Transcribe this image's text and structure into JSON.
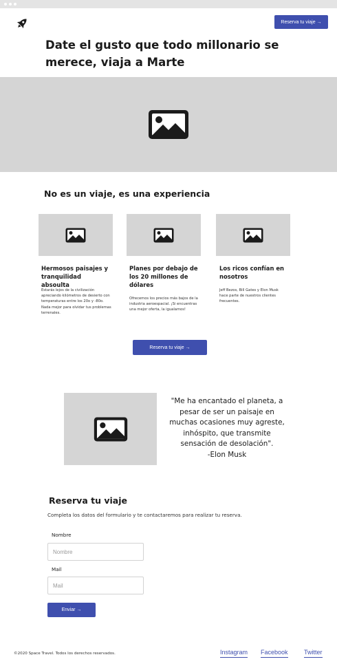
{
  "header": {
    "logo_icon": "rocket-icon",
    "cta_label": "Reserva tu viaje →"
  },
  "hero": {
    "title": "Date el gusto que todo millonario se merece, viaja a Marte",
    "image_icon": "image-icon"
  },
  "experience": {
    "title": "No es un viaje, es una experiencia",
    "cards": [
      {
        "title": "Hermosos paisajes y tranquilidad absoulta",
        "text": "Estarás lejos de la civilización apreciando kilómetros de desierto con temperaturas entre los 20o y -80o. Nada mejor para olvidar tus problemas terrenales."
      },
      {
        "title": "Planes por debajo de los 20 millones de dólares",
        "text": "Ofrecemos los precios más bajos de la industria aeroespacial. ¡Si encuentras una mejor oferta, la igualamos!"
      },
      {
        "title": "Los ricos confían en nosotros",
        "text": "Jeff Bezos, Bill Gates y Elon Musk hace parte de nuestros clientes frecuentes."
      }
    ],
    "cta_label": "Reserva tu viaje →"
  },
  "testimonial": {
    "quote": "\"Me ha encantado el planeta, a pesar de ser un paisaje en muchas ocasiones muy agreste, inhóspito, que transmite sensación de desolación\".",
    "author": "-Elon Musk"
  },
  "form": {
    "title": "Reserva tu viaje",
    "description": "Completa los datos del formulario y te contactaremos para realizar tu reserva.",
    "name_label": "Nombre",
    "name_placeholder": "Nombre",
    "mail_label": "Mail",
    "mail_placeholder": "Mail",
    "submit_label": "Enviar →"
  },
  "footer": {
    "copyright": "©2020 Space Travel. Todos los derechos reservados.",
    "links": [
      "Instagram",
      "Facebook",
      "Twitter"
    ]
  },
  "colors": {
    "accent": "#3f4fae",
    "placeholder_gray": "#d5d5d5",
    "chrome_bar": "#e4e4e4"
  }
}
